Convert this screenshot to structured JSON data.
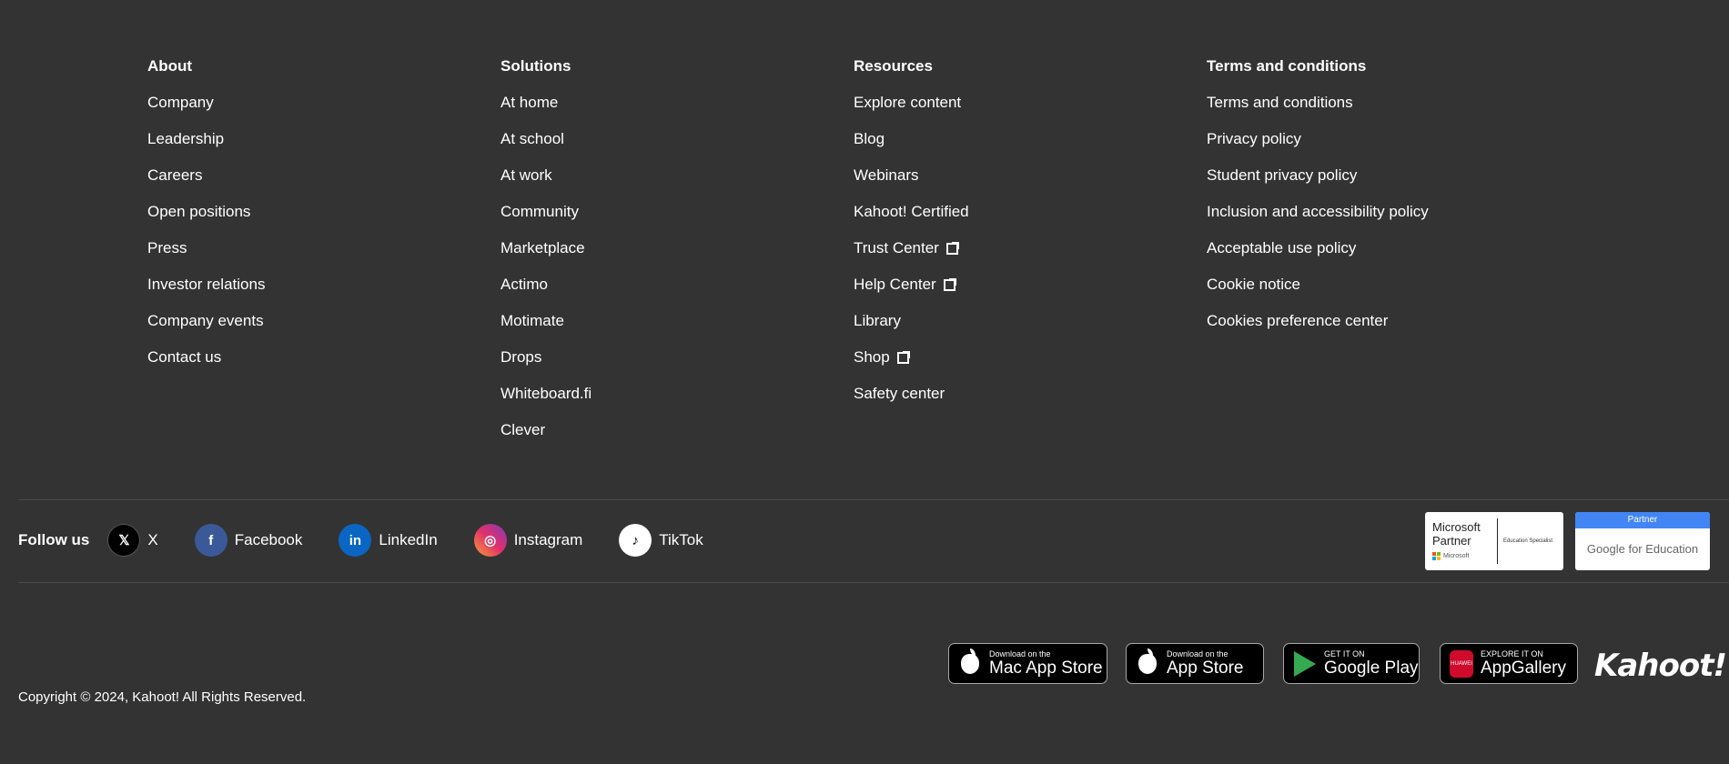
{
  "columns": [
    {
      "title": "About",
      "items": [
        {
          "label": "Company"
        },
        {
          "label": "Leadership"
        },
        {
          "label": "Careers"
        },
        {
          "label": "Open positions"
        },
        {
          "label": "Press"
        },
        {
          "label": "Investor relations"
        },
        {
          "label": "Company events"
        },
        {
          "label": "Contact us"
        }
      ]
    },
    {
      "title": "Solutions",
      "items": [
        {
          "label": "At home"
        },
        {
          "label": "At school"
        },
        {
          "label": "At work"
        },
        {
          "label": "Community"
        },
        {
          "label": "Marketplace"
        },
        {
          "label": "Actimo"
        },
        {
          "label": "Motimate"
        },
        {
          "label": "Drops"
        },
        {
          "label": "Whiteboard.fi"
        },
        {
          "label": "Clever"
        }
      ]
    },
    {
      "title": "Resources",
      "items": [
        {
          "label": "Explore content"
        },
        {
          "label": "Blog"
        },
        {
          "label": "Webinars"
        },
        {
          "label": "Kahoot! Certified"
        },
        {
          "label": "Trust Center",
          "external": true
        },
        {
          "label": "Help Center",
          "external": true
        },
        {
          "label": "Library"
        },
        {
          "label": "Shop",
          "external": true
        },
        {
          "label": "Safety center"
        }
      ]
    },
    {
      "title": "Terms and conditions",
      "items": [
        {
          "label": "Terms and conditions"
        },
        {
          "label": "Privacy policy"
        },
        {
          "label": "Student privacy policy"
        },
        {
          "label": "Inclusion and accessibility policy"
        },
        {
          "label": "Acceptable use policy"
        },
        {
          "label": "Cookie notice"
        },
        {
          "label": "Cookies preference center"
        }
      ]
    }
  ],
  "follow": {
    "label": "Follow us",
    "socials": [
      {
        "name": "X",
        "icon": "x-icon",
        "glyph": "𝕏"
      },
      {
        "name": "Facebook",
        "icon": "facebook-icon",
        "glyph": "f"
      },
      {
        "name": "LinkedIn",
        "icon": "linkedin-icon",
        "glyph": "in"
      },
      {
        "name": "Instagram",
        "icon": "instagram-icon",
        "glyph": "◎"
      },
      {
        "name": "TikTok",
        "icon": "tiktok-icon",
        "glyph": "♪"
      }
    ]
  },
  "badges": {
    "microsoft": {
      "line1": "Microsoft",
      "line2": "Partner",
      "sub": "Microsoft",
      "right": "Education Specialist"
    },
    "google": {
      "top": "Partner",
      "bottom": "Google for Education"
    }
  },
  "stores": [
    {
      "name": "mac-app-store",
      "small": "Download on the",
      "big": "Mac App Store",
      "icon": "apple-icon"
    },
    {
      "name": "app-store",
      "small": "Download on the",
      "big": "App Store",
      "icon": "apple-icon"
    },
    {
      "name": "google-play",
      "small": "GET IT ON",
      "big": "Google Play",
      "icon": "google-play-icon"
    },
    {
      "name": "app-gallery",
      "small": "EXPLORE IT ON",
      "big": "AppGallery",
      "icon": "huawei-icon",
      "icon_text": "HUAWEI"
    }
  ],
  "logo": "Kahoot!",
  "copyright": "Copyright © 2024, Kahoot! All Rights Reserved.",
  "colors": {
    "background": "#333333",
    "text": "#ffffff",
    "facebook": "#3b5998",
    "linkedin": "#0a66c2",
    "google_partner": "#4285f4",
    "huawei": "#cf0a2c"
  }
}
